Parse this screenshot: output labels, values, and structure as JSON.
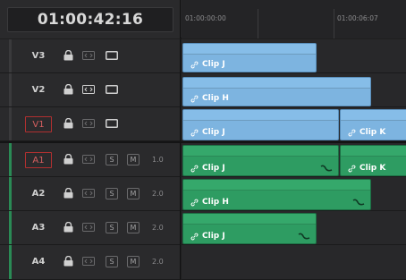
{
  "timecode": "01:00:42:16",
  "ruler": {
    "labels": [
      "01:00:00:00",
      "01:00:06:07"
    ]
  },
  "tracks": [
    {
      "id": "V3",
      "type": "video",
      "active": false,
      "buttons": [],
      "level": ""
    },
    {
      "id": "V2",
      "type": "video",
      "active": false,
      "buttons": [],
      "level": ""
    },
    {
      "id": "V1",
      "type": "video",
      "active": true,
      "buttons": [],
      "level": ""
    },
    {
      "id": "A1",
      "type": "audio",
      "active": true,
      "buttons": [
        "S",
        "M"
      ],
      "level": "1.0"
    },
    {
      "id": "A2",
      "type": "audio",
      "active": false,
      "buttons": [
        "S",
        "M"
      ],
      "level": "2.0"
    },
    {
      "id": "A3",
      "type": "audio",
      "active": false,
      "buttons": [
        "S",
        "M"
      ],
      "level": "2.0"
    },
    {
      "id": "A4",
      "type": "audio",
      "active": false,
      "buttons": [
        "S",
        "M"
      ],
      "level": "2.0"
    }
  ],
  "clips": {
    "v3_j": "Clip J",
    "v2_h": "Clip H",
    "v1_j": "Clip J",
    "v1_k": "Clip K",
    "a1_j": "Clip J",
    "a1_k": "Clip K",
    "a2_h": "Clip H",
    "a3_j": "Clip J"
  },
  "icons": {
    "lock": "lock-icon",
    "auto_select": "auto-select-icon",
    "monitor": "monitor-icon",
    "link": "link-icon",
    "waveform": "waveform-icon"
  },
  "colors": {
    "video_clip": "#7db4e0",
    "audio_clip": "#2e9c62",
    "audio_accent": "#2a8a55",
    "active_track_border": "#b03030"
  }
}
